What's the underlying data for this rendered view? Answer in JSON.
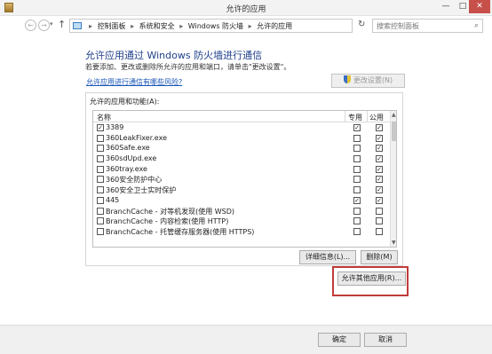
{
  "window": {
    "title": "允许的应用",
    "min_glyph": "—",
    "max_glyph": "□",
    "close_glyph": "✕"
  },
  "address_bar": {
    "back_glyph": "←",
    "forward_glyph": "→",
    "up_glyph": "↑",
    "breadcrumbs": [
      "控制面板",
      "系统和安全",
      "Windows 防火墙",
      "允许的应用"
    ],
    "separator": "▸",
    "search_placeholder": "搜索控制面板"
  },
  "content": {
    "heading": "允许应用通过 Windows 防火墙进行通信",
    "subtext": "若要添加、更改或删除所允许的应用和端口，请单击\"更改设置\"。",
    "risk_link": "允许应用进行通信有哪些风险?",
    "change_settings_label": "更改设置(N)",
    "group_label": "允许的应用和功能(A):",
    "columns": {
      "name": "名称",
      "private": "专用",
      "public": "公用"
    },
    "rows": [
      {
        "name": "3389",
        "enabled": true,
        "private": true,
        "public": true
      },
      {
        "name": "360LeakFixer.exe",
        "enabled": false,
        "private": false,
        "public": true
      },
      {
        "name": "360Safe.exe",
        "enabled": false,
        "private": false,
        "public": true
      },
      {
        "name": "360sdUpd.exe",
        "enabled": false,
        "private": false,
        "public": true
      },
      {
        "name": "360tray.exe",
        "enabled": false,
        "private": false,
        "public": true
      },
      {
        "name": "360安全防护中心",
        "enabled": false,
        "private": false,
        "public": true
      },
      {
        "name": "360安全卫士实时保护",
        "enabled": false,
        "private": false,
        "public": true
      },
      {
        "name": "445",
        "enabled": false,
        "private": true,
        "public": true
      },
      {
        "name": "BranchCache - 对等机发现(使用 WSD)",
        "enabled": false,
        "private": false,
        "public": false
      },
      {
        "name": "BranchCache - 内容检索(使用 HTTP)",
        "enabled": false,
        "private": false,
        "public": false
      },
      {
        "name": "BranchCache - 托管缓存服务器(使用 HTTPS)",
        "enabled": false,
        "private": false,
        "public": false
      }
    ],
    "details_label": "详细信息(L)...",
    "remove_label": "删除(M)",
    "allow_other_label": "允许其他应用(R)..."
  },
  "footer": {
    "ok_label": "确定",
    "cancel_label": "取消"
  },
  "colors": {
    "heading": "#1e3f8a",
    "link": "#1a56b8",
    "highlight": "#c23b3b",
    "close_button": "#c7504a"
  }
}
